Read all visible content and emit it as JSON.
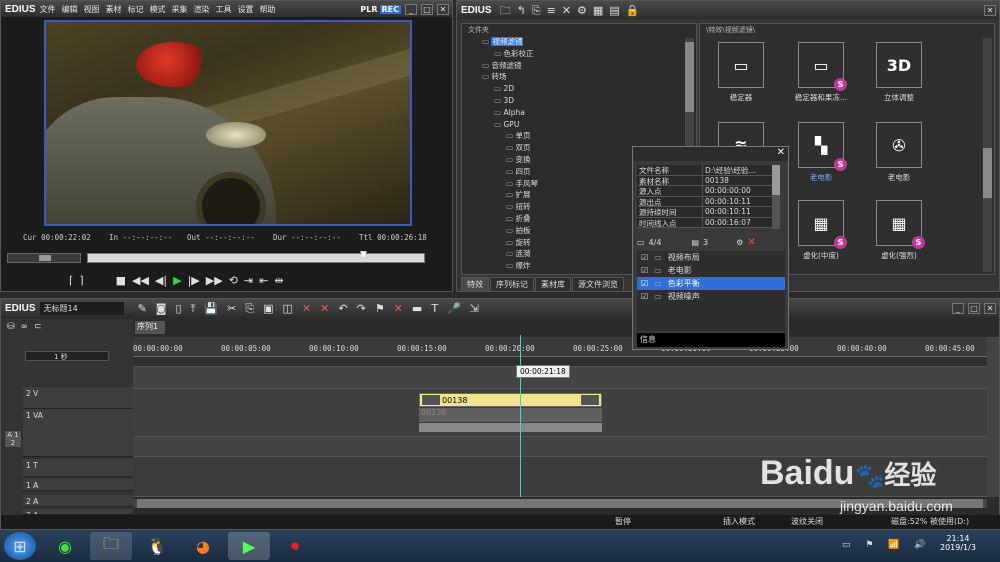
{
  "app": {
    "logo": "EDIUS",
    "menu": [
      "文件",
      "编辑",
      "视图",
      "素材",
      "标记",
      "模式",
      "采集",
      "渲染",
      "工具",
      "设置",
      "帮助"
    ],
    "plr": "PLR",
    "rec": "REC"
  },
  "player": {
    "cur_label": "Cur",
    "cur": "00:00:22:02",
    "in_label": "In",
    "in": "--:--:--:--",
    "out_label": "Out",
    "out": "--:--:--:--",
    "dur_label": "Dur",
    "dur": "--:--:--:--",
    "ttl_label": "Ttl",
    "ttl": "00:00:26:18"
  },
  "bin": {
    "logo": "EDIUS",
    "tree_header": "文件夹",
    "path": "\\特效\\视频滤镜\\",
    "tabs": [
      "特效",
      "序列标记",
      "素材库",
      "源文件浏览"
    ],
    "tree": [
      "视频滤镜",
      "色彩校正",
      "音频滤镜",
      "转场",
      "2D",
      "3D",
      "Alpha",
      "GPU",
      "单页",
      "双页",
      "变换",
      "四页",
      "手风琴",
      "扩展",
      "扭转",
      "折叠",
      "拍板",
      "旋转",
      "涟漪",
      "爆炸"
    ],
    "effects": [
      {
        "label": "稳定器",
        "icon": "frame-icon",
        "badge": ""
      },
      {
        "label": "稳定器和果冻...",
        "icon": "frame-icon",
        "badge": "S"
      },
      {
        "label": "立体调整",
        "icon": "3d-icon",
        "badge": ""
      },
      {
        "label": "",
        "icon": "layers-icon",
        "badge": ""
      },
      {
        "label": "老电影",
        "icon": "film-squares-icon",
        "badge": "S"
      },
      {
        "label": "老电影",
        "icon": "reel-icon",
        "badge": ""
      },
      {
        "label": "",
        "icon": "grid-icon",
        "badge": ""
      },
      {
        "label": "虚化(中度)",
        "icon": "grid-icon",
        "badge": "S"
      },
      {
        "label": "虚化(强烈)",
        "icon": "grid-icon",
        "badge": "S"
      }
    ],
    "effect_3d_text": "3D"
  },
  "info": {
    "rows": [
      [
        "文件名称",
        "D:\\经验\\经验..."
      ],
      [
        "素材名称",
        "00138"
      ],
      [
        "源入点",
        "00:00:00:00"
      ],
      [
        "源出点",
        "00:00:10:11"
      ],
      [
        "源持续时间",
        "00:00:10:11"
      ],
      [
        "时间线入点",
        "00:00:16:07"
      ]
    ],
    "count": "4/4",
    "count2": "3",
    "filters": [
      "视频布局",
      "老电影",
      "色彩平衡",
      "视频噪声"
    ],
    "selected": 2,
    "footer": "信息"
  },
  "timeline": {
    "logo": "EDIUS",
    "project": "无标题14",
    "sequence_tab": "序列1",
    "scale": "1 秒",
    "ruler": [
      "00:00:00:00",
      "00:00:05:00",
      "00:00:10:00",
      "00:00:15:00",
      "00:00:20:00",
      "00:00:25:00",
      "00:00:30:00",
      "00:00:35:00",
      "00:00:40:00",
      "00:00:45:00"
    ],
    "cursor_time": "00:00:21:18",
    "tracks": [
      "2 V",
      "1 VA",
      "1 T",
      "1 A",
      "2 A",
      "3 A"
    ],
    "track_a12": "A 1 2",
    "clip_name": "00138",
    "clip_name_audio": "00138"
  },
  "status": {
    "pause": "暂停",
    "insert": "插入模式",
    "ripple": "波纹关闭",
    "disk": "磁盘:52% 被使用(D:)"
  },
  "taskbar": {
    "time": "21:14",
    "date": "2019/1/3"
  },
  "watermark": {
    "brand": "Baidu",
    "tail": "经验",
    "url": "jingyan.baidu.com"
  }
}
